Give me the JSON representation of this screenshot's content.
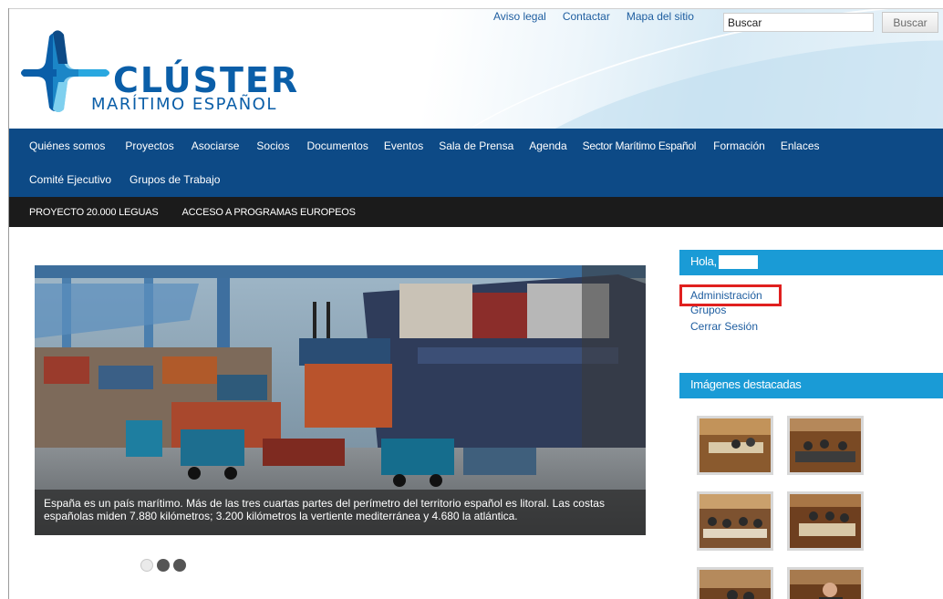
{
  "header": {
    "logo_title": "CLÚSTER",
    "logo_subtitle": "MARÍTIMO ESPAÑOL",
    "top_links": [
      "Aviso legal",
      "Contactar",
      "Mapa del sitio"
    ],
    "search": {
      "value": "Buscar",
      "button_label": "Buscar"
    }
  },
  "main_nav": {
    "row1": [
      "Quiénes somos",
      "Proyectos",
      "Asociarse",
      "Socios",
      "Documentos",
      "Eventos",
      "Sala de Prensa",
      "Agenda",
      "Sector Marítimo Español",
      "Formación",
      "Enlaces"
    ],
    "row2": [
      "Comité Ejecutivo",
      "Grupos de Trabajo"
    ]
  },
  "sub_nav": [
    "PROYECTO 20.000 LEGUAS",
    "ACCESO A PROGRAMAS EUROPEOS"
  ],
  "slider": {
    "caption": "España es un país marítimo. Más de las tres cuartas partes del perímetro del territorio español es litoral. Las costas españolas miden 7.880 kilómetros; 3.200 kilómetros la vertiente mediterránea y 4.680 la atlántica.",
    "slide_count": 3,
    "active_slide": 1
  },
  "user_widget": {
    "greeting": "Hola,",
    "links": [
      "Administración",
      "Grupos",
      "Cerrar Sesión"
    ]
  },
  "gallery_widget": {
    "title": "Imágenes destacadas"
  },
  "colors": {
    "main_nav_bg": "#0d4a86",
    "sub_nav_bg": "#1b1b1b",
    "widget_header_bg": "#1a9bd6",
    "link": "#1f5ea0",
    "highlight_border": "#e0201f"
  }
}
